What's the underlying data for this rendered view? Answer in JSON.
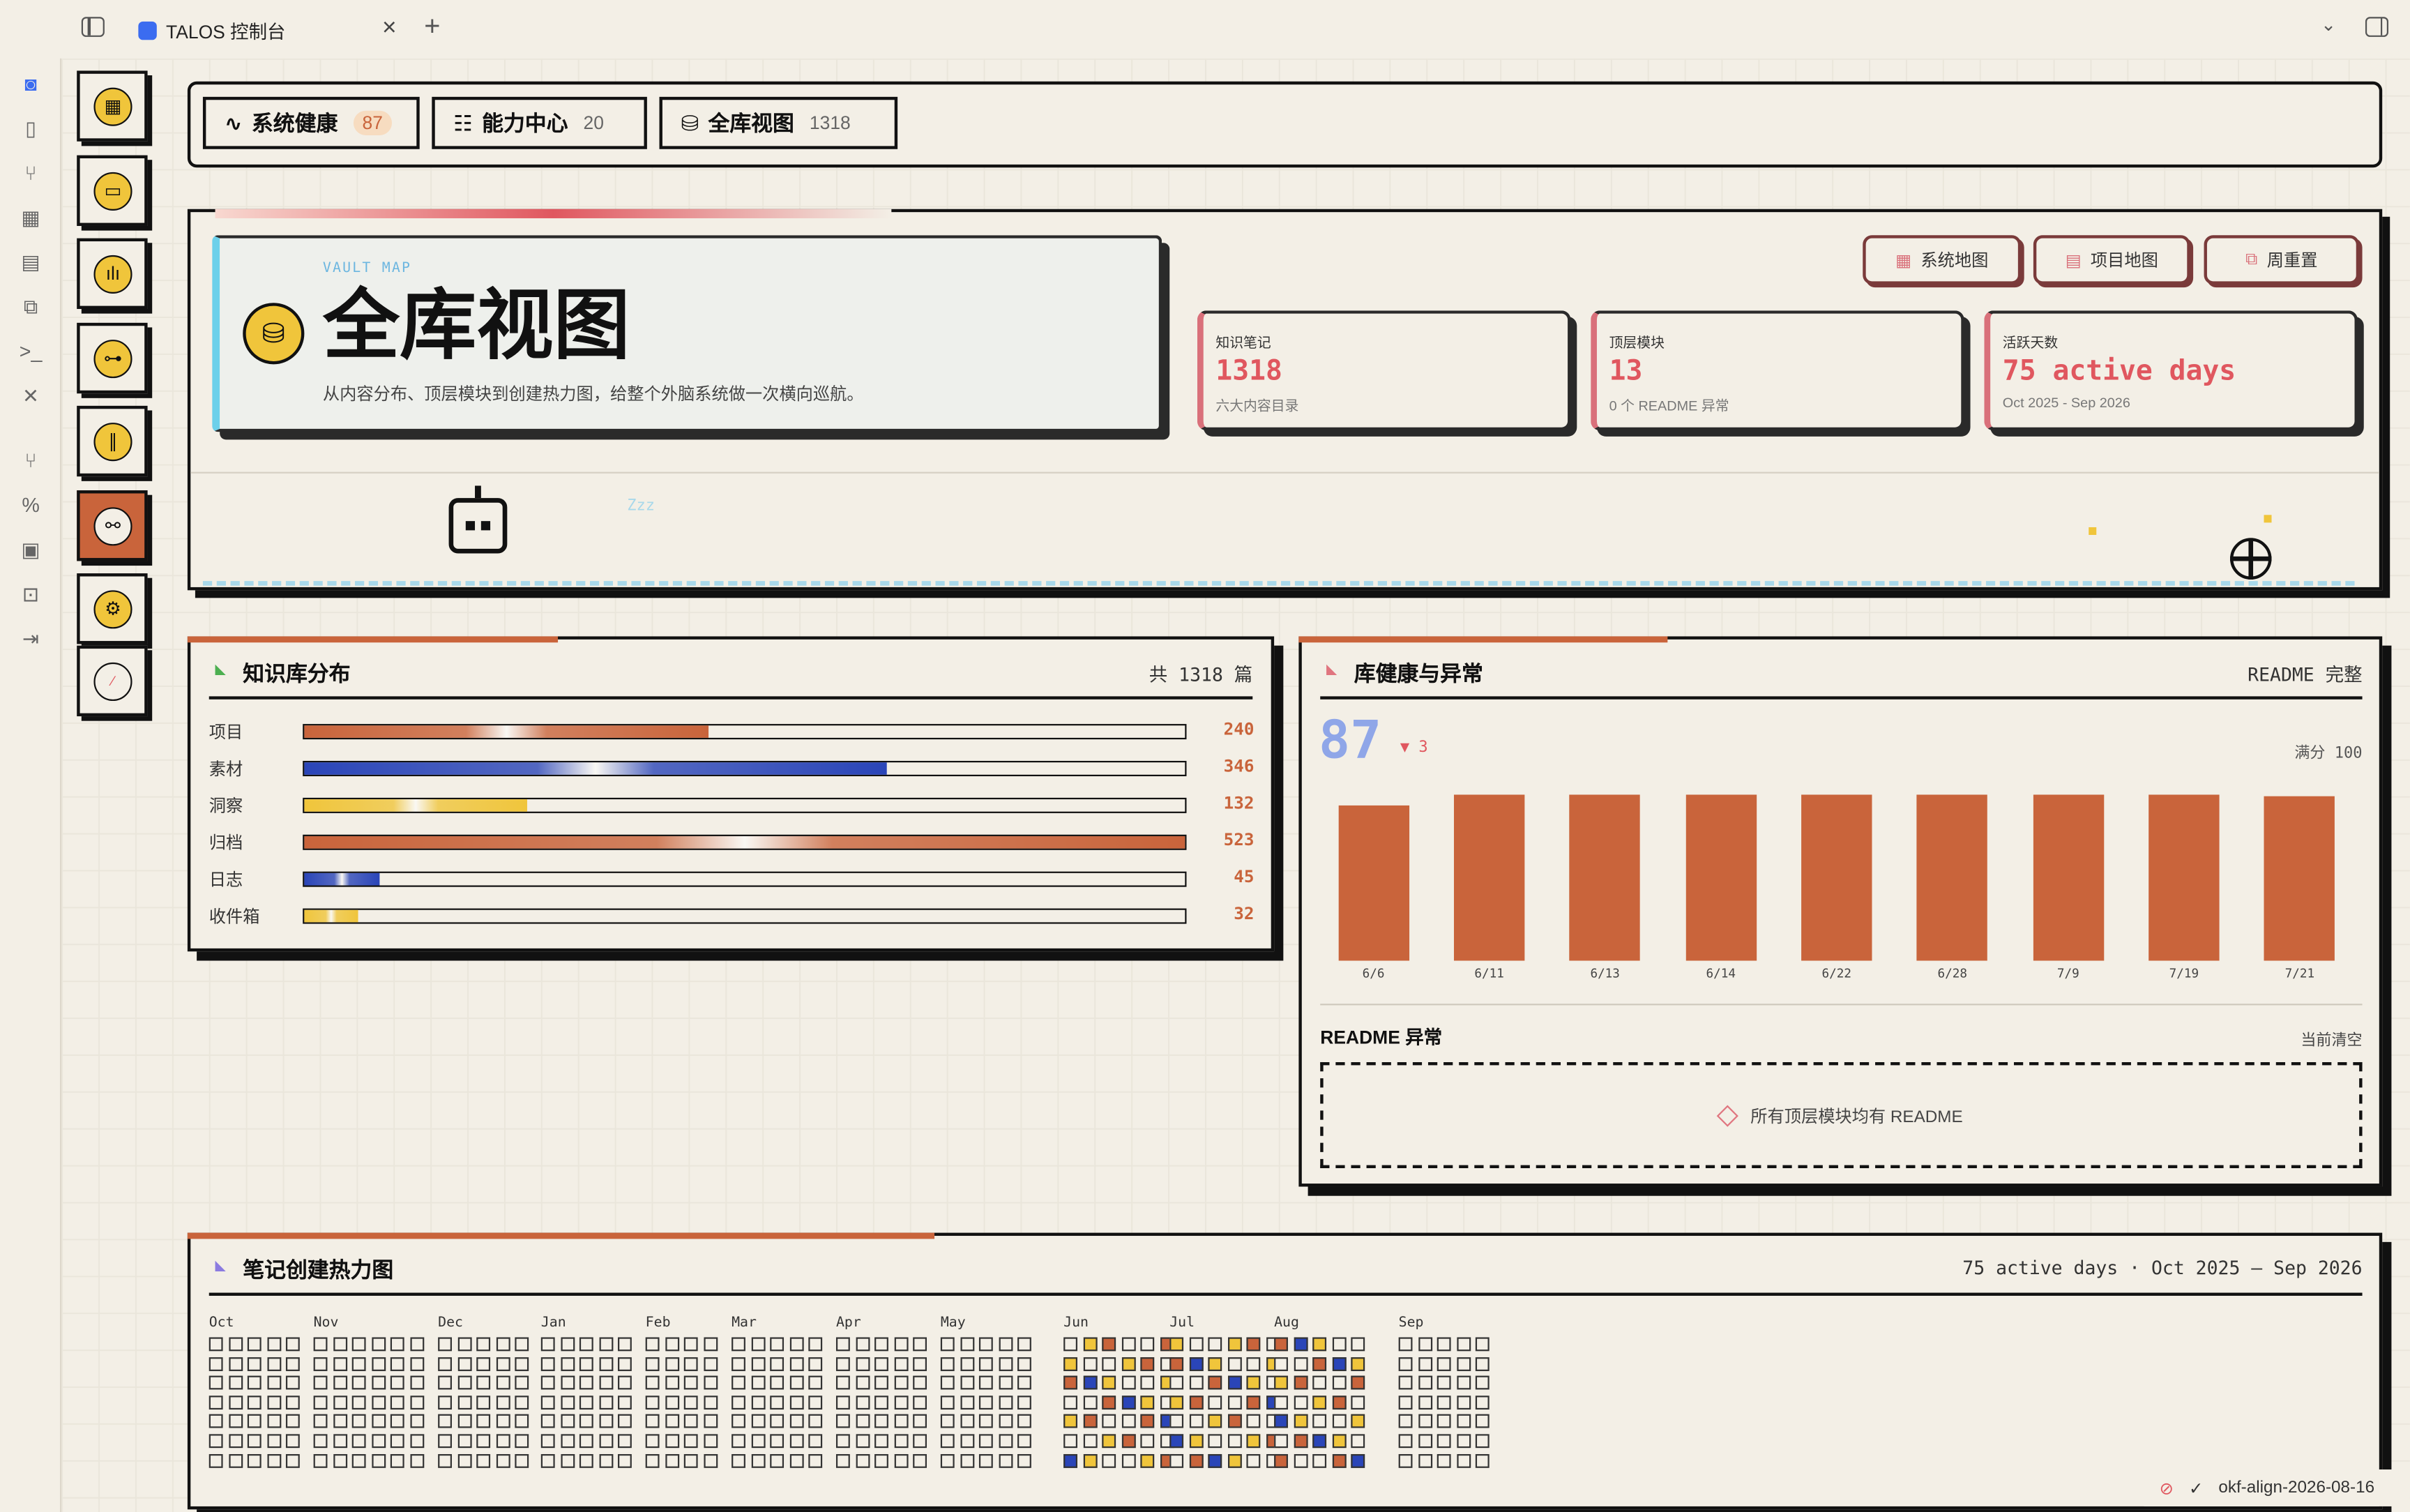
{
  "titlebar": {
    "tab_title": "TALOS 控制台",
    "new_tab": "+",
    "close": "×"
  },
  "rail_icons": [
    "talos-icon",
    "file-search-icon",
    "graph-icon",
    "grid-icon",
    "calendar-icon",
    "copy-icon",
    "terminal-icon",
    "tools-icon",
    "git-icon",
    "percent-icon",
    "chip-icon",
    "robot-icon",
    "export-icon"
  ],
  "nav_icons": [
    "dashboard-icon",
    "chat-icon",
    "audio-icon",
    "link-icon",
    "library-icon",
    "share-icon",
    "settings-icon",
    "compass-icon"
  ],
  "top_tabs": [
    {
      "icon": "∿",
      "label": "系统健康",
      "count": "87"
    },
    {
      "icon": "☷",
      "label": "能力中心",
      "count": "20"
    },
    {
      "icon": "⛁",
      "label": "全库视图",
      "count": "1318"
    }
  ],
  "hero": {
    "eyebrow": "VAULT MAP",
    "title": "全库视图",
    "subtitle": "从内容分布、顶层模块到创建热力图，给整个外脑系统做一次横向巡航。",
    "zzz": "Zzz",
    "buttons": [
      {
        "icon": "▦",
        "label": "系统地图"
      },
      {
        "icon": "▤",
        "label": "项目地图"
      },
      {
        "icon": "⧉",
        "label": "周重置"
      }
    ],
    "stats": [
      {
        "label": "知识笔记",
        "value": "1318",
        "sub": "六大内容目录"
      },
      {
        "label": "顶层模块",
        "value": "13",
        "sub": "0 个 README 异常"
      },
      {
        "label": "活跃天数",
        "value": "75 active days",
        "sub": "Oct 2025 - Sep 2026"
      }
    ]
  },
  "distribution": {
    "title": "知识库分布",
    "total": "共 1318 篇",
    "rows": [
      {
        "label": "项目",
        "value": 240,
        "color": "#c9643b"
      },
      {
        "label": "素材",
        "value": 346,
        "color": "#2a45b8"
      },
      {
        "label": "洞察",
        "value": 132,
        "color": "#f0c53b"
      },
      {
        "label": "归档",
        "value": 523,
        "color": "#c9643b"
      },
      {
        "label": "日志",
        "value": 45,
        "color": "#2a45b8"
      },
      {
        "label": "收件箱",
        "value": 32,
        "color": "#f0c53b"
      }
    ],
    "max": 523
  },
  "health": {
    "title": "库健康与异常",
    "status": "README 完整",
    "score": "87",
    "delta": "▼ 3",
    "full": "满分 100",
    "readme_title": "README 异常",
    "readme_status": "当前清空",
    "readme_empty": "所有顶层模块均有 README"
  },
  "chart_data": {
    "type": "bar",
    "categories": [
      "6/6",
      "6/11",
      "6/13",
      "6/14",
      "6/22",
      "6/28",
      "7/9",
      "7/19",
      "7/21"
    ],
    "values": [
      84,
      90,
      90,
      90,
      90,
      90,
      90,
      90,
      89
    ],
    "ylim": [
      0,
      100
    ],
    "color": "#c9643b"
  },
  "heatmap": {
    "title": "笔记创建热力图",
    "summary": "75 active days · Oct 2025 — Sep 2026",
    "months": [
      "Oct",
      "Nov",
      "Dec",
      "Jan",
      "Feb",
      "Mar",
      "Apr",
      "May",
      "Jun",
      "Jul",
      "Aug",
      "Sep"
    ]
  },
  "statusbar": {
    "branch": "okf-align-2026-08-16",
    "check": "✓"
  }
}
